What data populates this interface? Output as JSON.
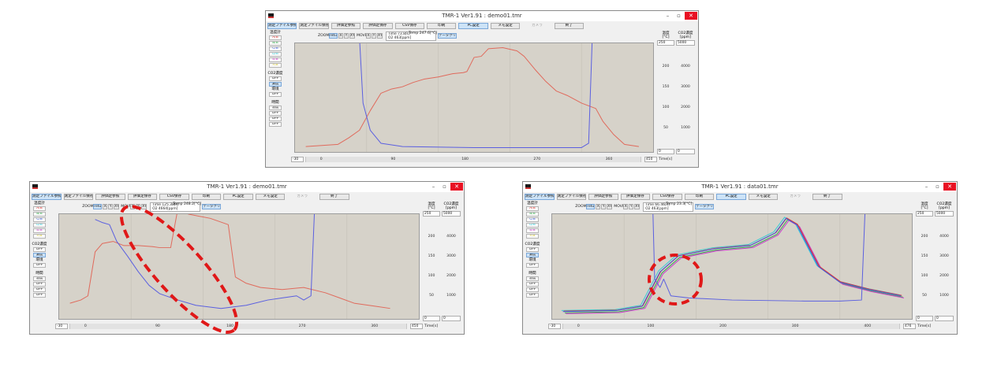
{
  "windows": [
    {
      "title": "TMR-1 Ver1.91 : demo01.tmr",
      "win_buttons": {
        "minimize": "–",
        "maximize": "▫",
        "close": "✕"
      },
      "menu": [
        "測定ファイル参照",
        "測定ファイル保存",
        "評価定参照",
        "評価定保存",
        "CSV保存",
        "印刷",
        "PC設定",
        "メモ設定",
        "カメラ",
        "終了"
      ],
      "left_panel": {
        "thermo_label": "温度計",
        "channels": [
          "A/B",
          "B/B",
          "C/B",
          "D/B",
          "E/B",
          "F/B"
        ],
        "co2_label": "CO2濃度",
        "co2_buttons": [
          "OFF",
          "濃度"
        ],
        "diff_label": "環境",
        "diff_button": "OFF",
        "time_label": "時間",
        "time_buttons": [
          "温度",
          "OFF",
          "OFF",
          "OFF"
        ]
      },
      "toolbar": {
        "zoom": "ZOOM",
        "return": "return",
        "x": "X",
        "y": "Y",
        "xy": "XY",
        "move": "MOVE",
        "time": "Time  73.8[s]",
        "co2": "O2  463[ppm]",
        "temp": ": Temp  247.6[°C]",
        "data_clear": "データクリア"
      },
      "x_axis": {
        "ticks": [
          "0",
          "90",
          "180",
          "270",
          "360"
        ],
        "min_box": "-30",
        "max_box": "450",
        "unit": "Time[s]"
      },
      "temp_axis": {
        "title": "温度\n[°C]",
        "max": "250",
        "min": "0",
        "ticks": [
          "200",
          "150",
          "100",
          "50"
        ]
      },
      "co2_axis": {
        "title": "CO2濃度\n[ppm]",
        "max": "5000",
        "min": "0",
        "ticks": [
          "4000",
          "3000",
          "2000",
          "1000"
        ]
      }
    },
    {
      "title": "TMR-1 Ver1.91 : demo01.tmr",
      "win_buttons": {
        "minimize": "–",
        "maximize": "▫",
        "close": "✕"
      },
      "menu": [
        "測定ファイル参照",
        "測定ファイル保存",
        "評価定参照",
        "評価定保存",
        "CSV保存",
        "印刷",
        "PC設定",
        "メモ設定",
        "カメラ",
        "終了"
      ],
      "left_panel": {
        "thermo_label": "温度計",
        "channels": [
          "A/B",
          "B/B",
          "C/B",
          "D/B",
          "E/B",
          "F/B"
        ],
        "co2_label": "CO2濃度",
        "co2_buttons": [
          "OFF",
          "濃度"
        ],
        "diff_label": "環境",
        "diff_button": "OFF",
        "time_label": "時間",
        "time_buttons": [
          "温度",
          "OFF",
          "OFF",
          "OFF"
        ]
      },
      "toolbar": {
        "zoom": "ZOOM",
        "return": "return",
        "x": "X",
        "y": "Y",
        "xy": "XY",
        "move": "MOVE",
        "time": "Time  125.38[s]",
        "co2": "O2  4664[ppm]",
        "temp": ": Temp  248.2[°C]",
        "data_clear": "データクリア"
      },
      "x_axis": {
        "ticks": [
          "0",
          "90",
          "180",
          "270",
          "360"
        ],
        "min_box": "-30",
        "max_box": "450",
        "unit": "Time[s]"
      },
      "temp_axis": {
        "title": "温度\n[°C]",
        "max": "250",
        "min": "0",
        "ticks": [
          "200",
          "150",
          "100",
          "50"
        ]
      },
      "co2_axis": {
        "title": "CO2濃度\n[ppm]",
        "max": "5000",
        "min": "0",
        "ticks": [
          "4000",
          "3000",
          "2000",
          "1000"
        ]
      }
    },
    {
      "title": "TMR-1 Ver1.91 : data01.tmr",
      "win_buttons": {
        "minimize": "–",
        "maximize": "▫",
        "close": "✕"
      },
      "menu": [
        "測定ファイル参照",
        "測定ファイル保存",
        "評価定参照",
        "評価定保存",
        "CSV保存",
        "印刷",
        "PC設定",
        "メモ設定",
        "カメラ",
        "終了"
      ],
      "left_panel": {
        "thermo_label": "温度計",
        "channels": [
          "A/B",
          "B/B",
          "C/B",
          "D/B",
          "E/B",
          "F/B"
        ],
        "co2_label": "CO2濃度",
        "co2_buttons": [
          "OFF",
          "濃度"
        ],
        "diff_label": "環境",
        "diff_button": "OFF",
        "time_label": "時間",
        "time_buttons": [
          "温度",
          "OFF",
          "OFF",
          "OFF"
        ]
      },
      "toolbar": {
        "zoom": "ZOOM",
        "return": "return",
        "x": "X",
        "y": "Y",
        "xy": "XY",
        "move": "MOVE",
        "time": "Time  66.46[s]",
        "co2": "O2  463[ppm]",
        "temp": ": Temp  23.3[°C]",
        "data_clear": "データクリア"
      },
      "x_axis": {
        "ticks": [
          "0",
          "100",
          "200",
          "300",
          "400"
        ],
        "min_box": "-30",
        "max_box": "476",
        "unit": "Time[s]"
      },
      "temp_axis": {
        "title": "温度\n[°C]",
        "max": "250",
        "min": "0",
        "ticks": [
          "200",
          "150",
          "100",
          "50"
        ]
      },
      "co2_axis": {
        "title": "CO2濃度\n[ppm]",
        "max": "5000",
        "min": "0",
        "ticks": [
          "4000",
          "3000",
          "2000",
          "1000"
        ]
      }
    }
  ],
  "colors": {
    "channels": [
      "#e0342f",
      "#31a848",
      "#3c5ddc",
      "#39cbd6",
      "#cc39cc",
      "#d6c93a"
    ],
    "temp_trace": "#e06a5c",
    "co2_trace": "#5a5fe0",
    "plot_bg": "#d6d2c9",
    "highlight": "#e01818"
  }
}
